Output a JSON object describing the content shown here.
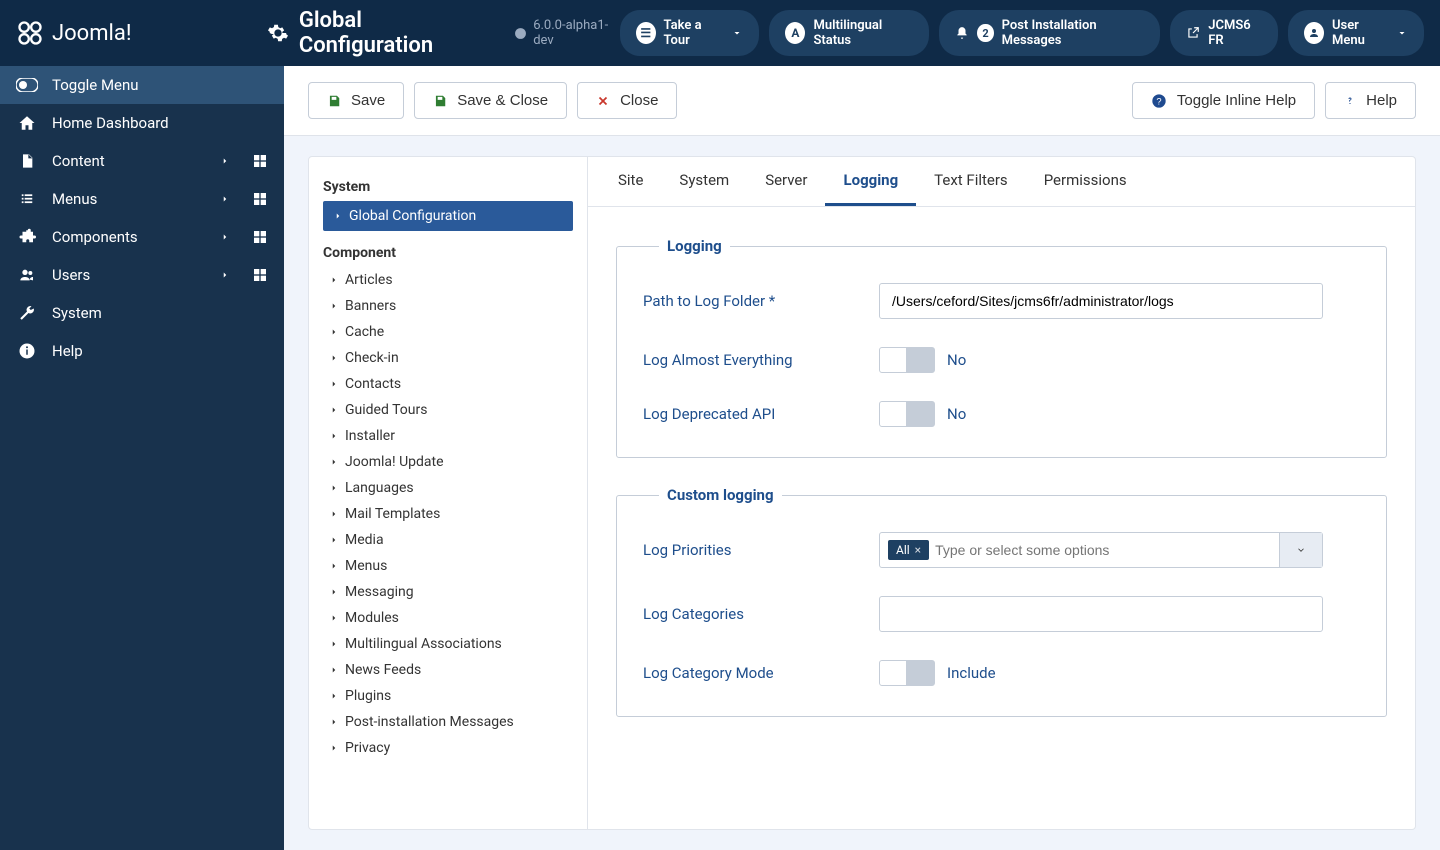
{
  "header": {
    "brand": "Joomla!",
    "page_title": "Global Configuration",
    "version": "6.0.0-alpha1-dev",
    "buttons": {
      "tour": "Take a Tour",
      "multilingual": "Multilingual Status",
      "post_install": "Post Installation Messages",
      "post_install_count": "2",
      "site_link": "JCMS6 FR",
      "user_menu": "User Menu"
    }
  },
  "sidebar": {
    "toggle": "Toggle Menu",
    "items": [
      {
        "label": "Home Dashboard"
      },
      {
        "label": "Content"
      },
      {
        "label": "Menus"
      },
      {
        "label": "Components"
      },
      {
        "label": "Users"
      },
      {
        "label": "System"
      },
      {
        "label": "Help"
      }
    ]
  },
  "toolbar": {
    "save": "Save",
    "save_close": "Save & Close",
    "close": "Close",
    "toggle_help": "Toggle Inline Help",
    "help": "Help"
  },
  "component_nav": {
    "system_heading": "System",
    "system_active": "Global Configuration",
    "component_heading": "Component",
    "items": [
      "Articles",
      "Banners",
      "Cache",
      "Check-in",
      "Contacts",
      "Guided Tours",
      "Installer",
      "Joomla! Update",
      "Languages",
      "Mail Templates",
      "Media",
      "Menus",
      "Messaging",
      "Modules",
      "Multilingual Associations",
      "News Feeds",
      "Plugins",
      "Post-installation Messages",
      "Privacy"
    ]
  },
  "tabs": [
    "Site",
    "System",
    "Server",
    "Logging",
    "Text Filters",
    "Permissions"
  ],
  "active_tab": "Logging",
  "logging_section": {
    "legend": "Logging",
    "path_label": "Path to Log Folder *",
    "path_value": "/Users/ceford/Sites/jcms6fr/administrator/logs",
    "log_everything_label": "Log Almost Everything",
    "log_everything_value": "No",
    "log_deprecated_label": "Log Deprecated API",
    "log_deprecated_value": "No"
  },
  "custom_section": {
    "legend": "Custom logging",
    "priorities_label": "Log Priorities",
    "priorities_tag": "All",
    "priorities_placeholder": "Type or select some options",
    "categories_label": "Log Categories",
    "mode_label": "Log Category Mode",
    "mode_value": "Include"
  }
}
